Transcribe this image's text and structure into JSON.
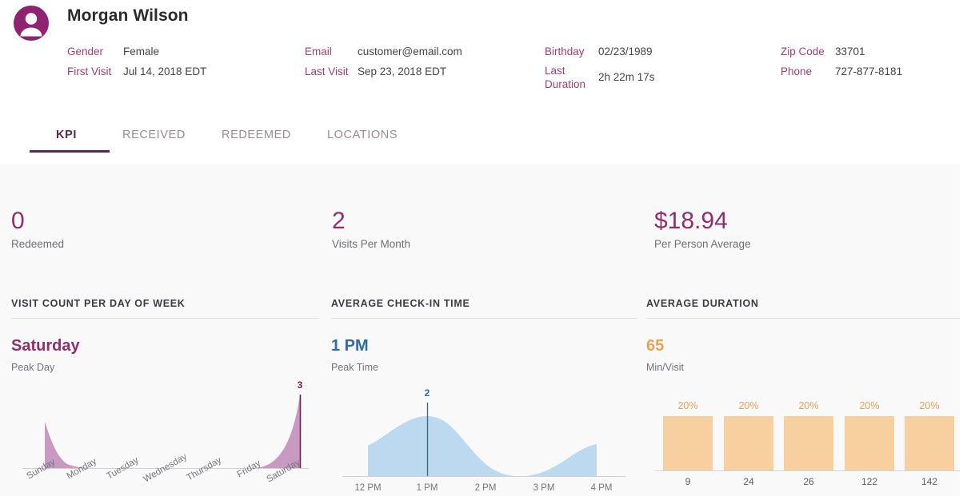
{
  "header": {
    "avatar_icon": "user-avatar-icon",
    "customer_name": "Morgan Wilson",
    "facts": {
      "gender_label": "Gender",
      "gender_value": "Female",
      "first_visit_label": "First Visit",
      "first_visit_value": "Jul 14, 2018 EDT",
      "email_label": "Email",
      "email_value": "customer@email.com",
      "last_visit_label": "Last Visit",
      "last_visit_value": "Sep 23, 2018 EDT",
      "birthday_label": "Birthday",
      "birthday_value": "02/23/1989",
      "last_duration_label_line1": "Last",
      "last_duration_label_line2": "Duration",
      "last_duration_value": "2h 22m 17s",
      "zip_label": "Zip Code",
      "zip_value": "33701",
      "phone_label": "Phone",
      "phone_value": "727-877-8181"
    }
  },
  "tabs": [
    {
      "label": "KPI",
      "active": true
    },
    {
      "label": "RECEIVED",
      "active": false
    },
    {
      "label": "REDEEMED",
      "active": false
    },
    {
      "label": "LOCATIONS",
      "active": false
    }
  ],
  "kpis": [
    {
      "value": "0",
      "label": "Redeemed"
    },
    {
      "value": "2",
      "label": "Visits Per Month"
    },
    {
      "value": "$18.94",
      "label": "Per Person Average"
    }
  ],
  "panels": {
    "day_of_week": {
      "title": "VISIT COUNT PER DAY OF WEEK",
      "headline": "Saturday",
      "sub": "Peak Day"
    },
    "checkin_time": {
      "title": "AVERAGE CHECK-IN TIME",
      "headline": "1 PM",
      "sub": "Peak Time"
    },
    "duration": {
      "title": "AVERAGE DURATION",
      "headline": "65",
      "sub": "Min/Visit"
    }
  },
  "colors": {
    "accent_purple": "#8e2f6b",
    "label_purple": "#9c3f73",
    "tab_active": "#5b2a49",
    "area_purple_fill": "#c89ac2",
    "marker_purple": "#6e2450",
    "area_blue_fill": "#bcd9f0",
    "marker_blue": "#3c6f84",
    "bar_orange": "#f8cf9e",
    "label_orange": "#e2a05a",
    "content_bg": "#f9f9fa"
  },
  "chart_data": [
    {
      "type": "area",
      "title": "VISIT COUNT PER DAY OF WEEK",
      "categories": [
        "Sunday",
        "Monday",
        "Tuesday",
        "Wednesday",
        "Thursday",
        "Friday",
        "Saturday"
      ],
      "values": [
        1,
        0,
        0,
        0,
        0,
        0,
        3
      ],
      "peak_label": "3",
      "peak_category": "Saturday",
      "xlabel": "",
      "ylabel": "",
      "ylim": [
        0,
        3
      ],
      "grid": false,
      "legend": "none"
    },
    {
      "type": "area",
      "title": "AVERAGE CHECK-IN TIME",
      "categories": [
        "12 PM",
        "1 PM",
        "2 PM",
        "3 PM",
        "4 PM"
      ],
      "values": [
        1,
        2,
        1.2,
        0,
        1
      ],
      "peak_label": "2",
      "peak_category": "1 PM",
      "xlabel": "",
      "ylabel": "",
      "ylim": [
        0,
        2
      ],
      "grid": false,
      "legend": "none"
    },
    {
      "type": "bar",
      "title": "AVERAGE DURATION",
      "categories": [
        "9",
        "24",
        "26",
        "122",
        "142"
      ],
      "values": [
        20,
        20,
        20,
        20,
        20
      ],
      "data_labels": [
        "20%",
        "20%",
        "20%",
        "20%",
        "20%"
      ],
      "xlabel": "",
      "ylabel": "",
      "ylim": [
        0,
        25
      ],
      "grid": false,
      "legend": "none"
    }
  ]
}
